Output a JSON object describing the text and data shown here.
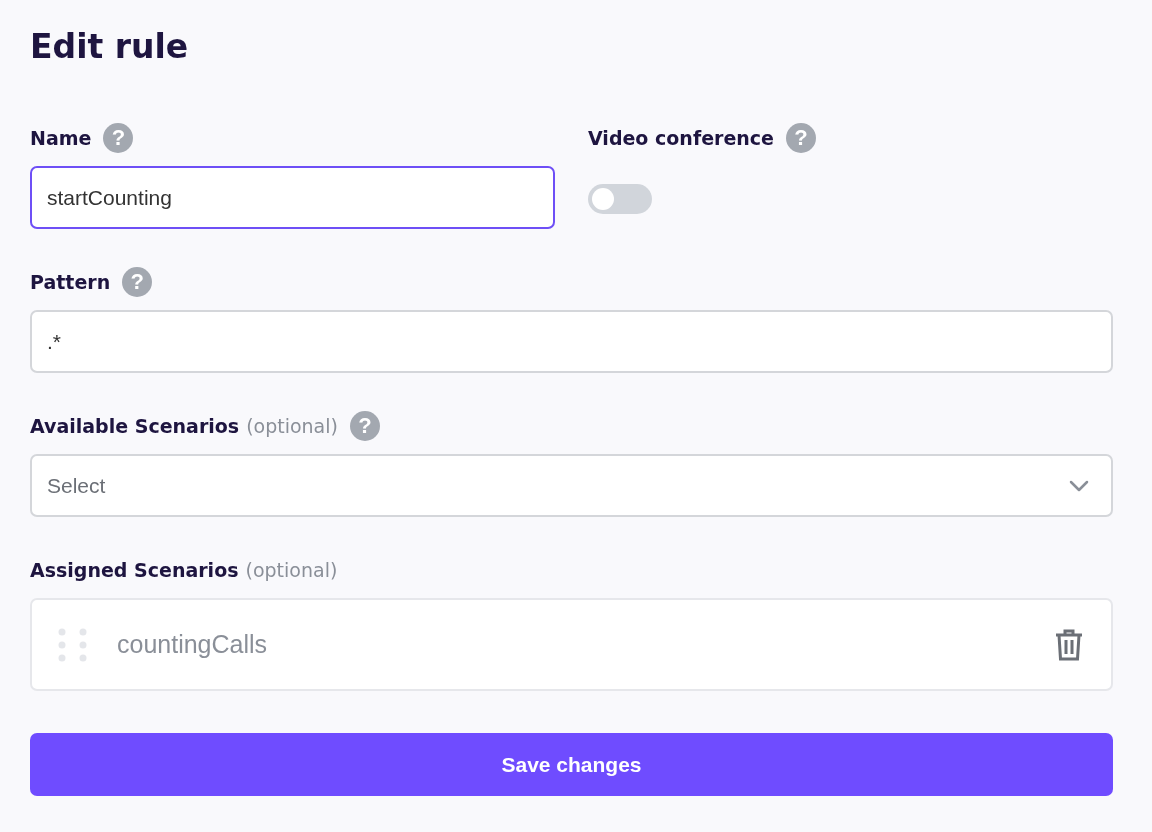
{
  "title": "Edit rule",
  "name_field": {
    "label": "Name",
    "help": "?",
    "value": "startCounting",
    "focused": true
  },
  "video_conference": {
    "label": "Video conference",
    "help": "?",
    "on": false
  },
  "pattern_field": {
    "label": "Pattern",
    "help": "?",
    "value": ".*",
    "focused": false
  },
  "available_scenarios": {
    "label": "Available Scenarios",
    "note": "(optional)",
    "help": "?",
    "placeholder": "Select"
  },
  "assigned_scenarios": {
    "label": "Assigned Scenarios",
    "note": "(optional)",
    "items": [
      {
        "name": "countingCalls"
      }
    ]
  },
  "save_button": {
    "label": "Save changes"
  }
}
